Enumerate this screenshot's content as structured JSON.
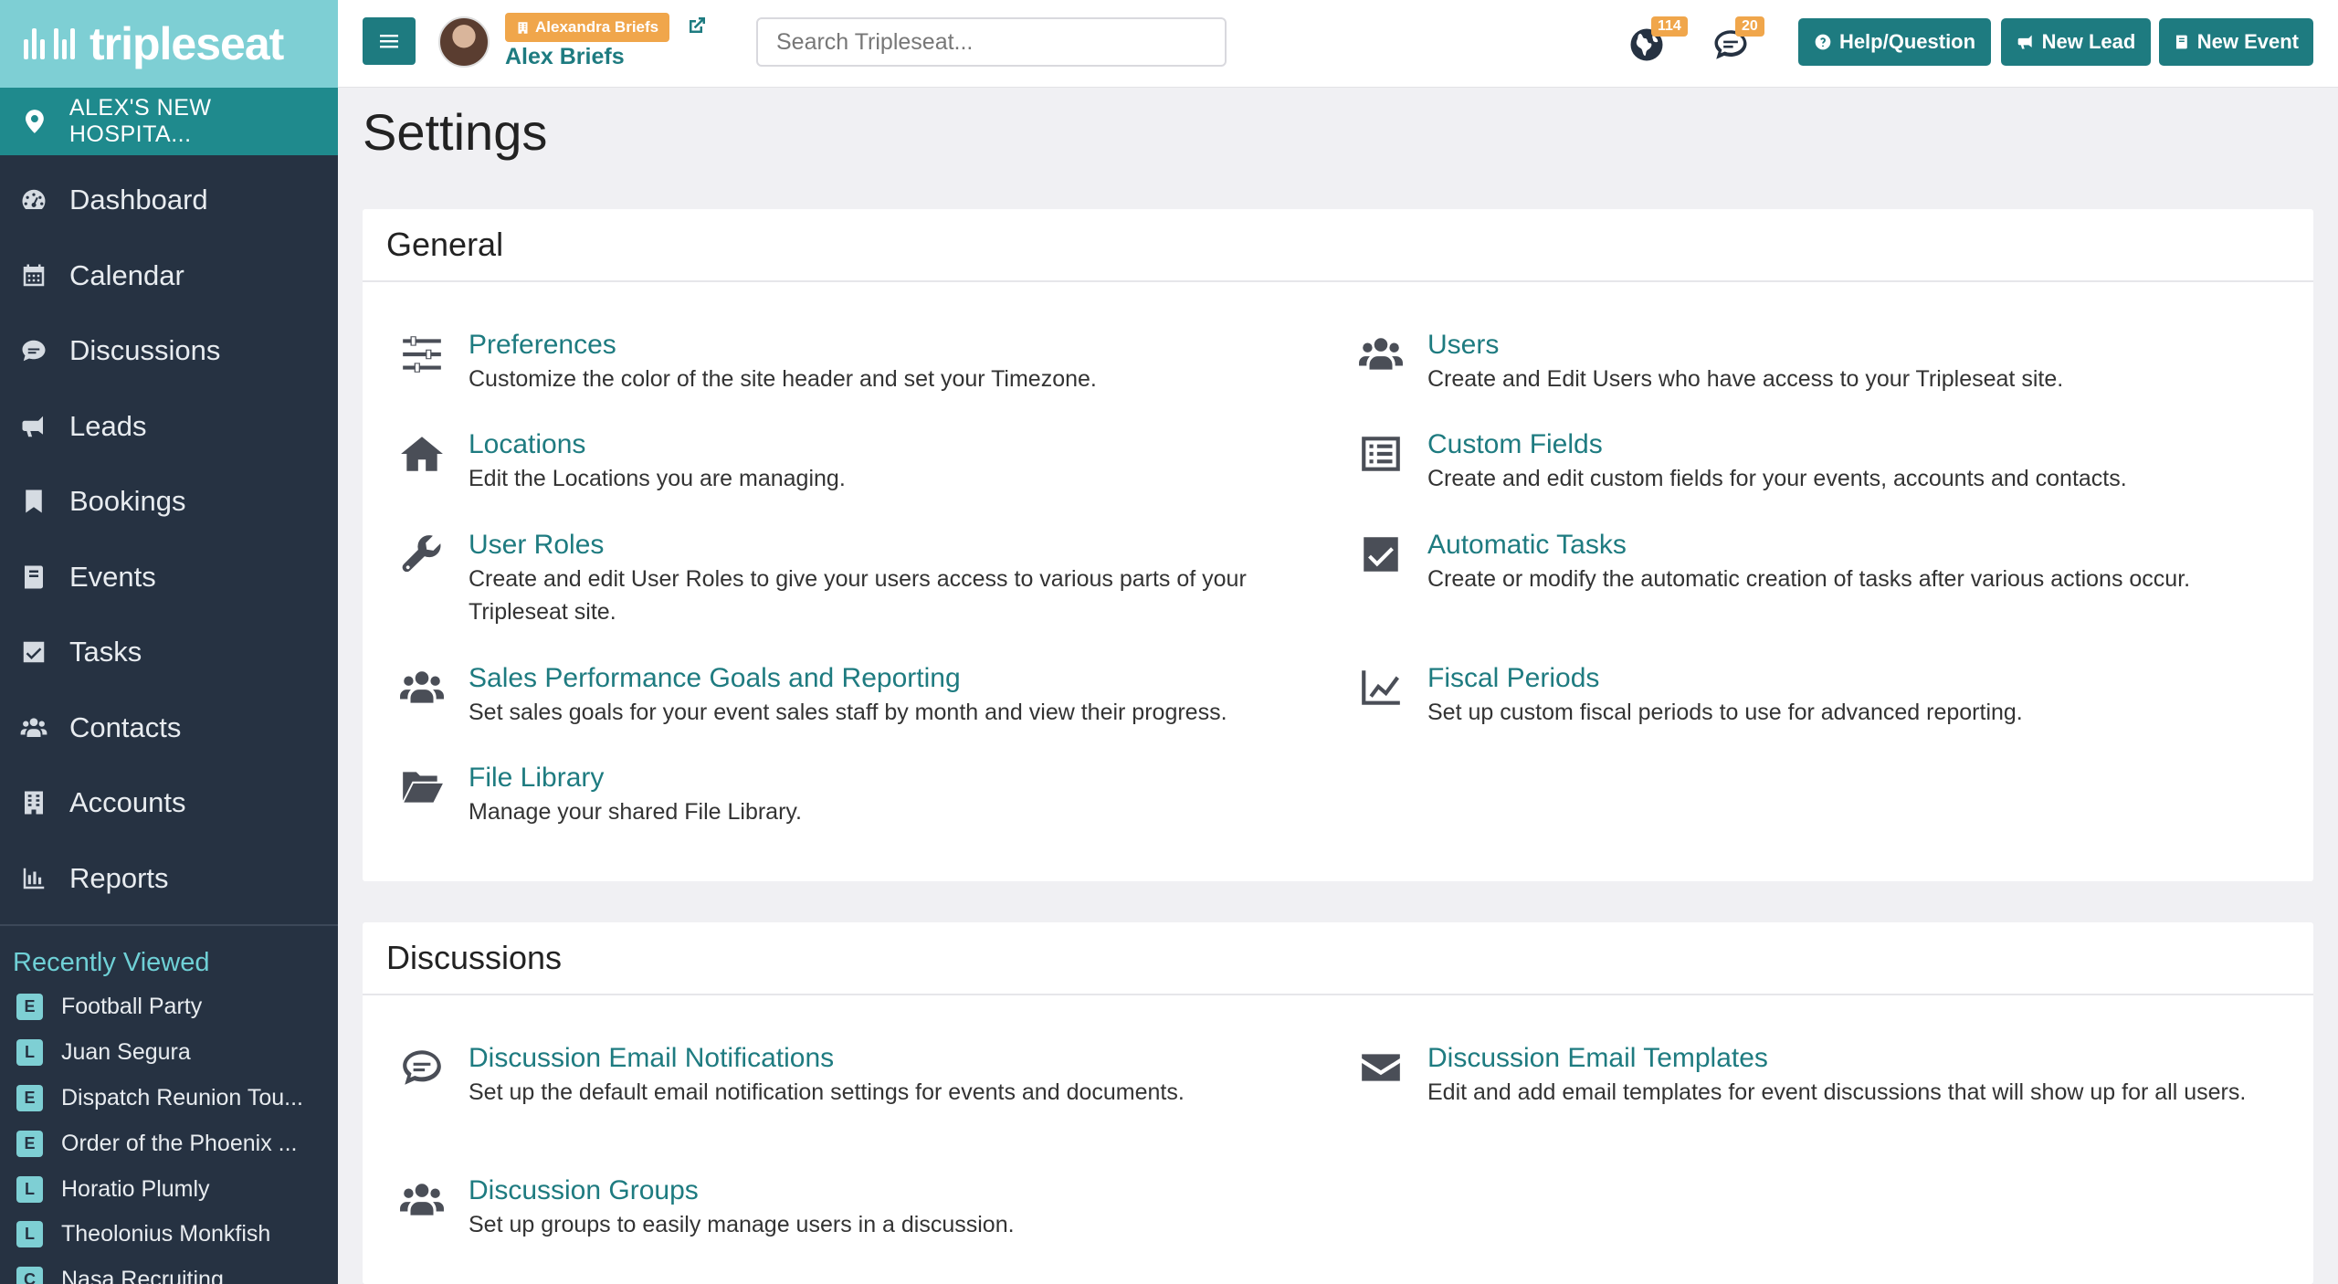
{
  "app": {
    "logo_text": "tripleseat"
  },
  "location": {
    "name": "ALEX'S NEW HOSPITA..."
  },
  "nav": [
    {
      "label": "Dashboard",
      "icon": "dashboard-icon"
    },
    {
      "label": "Calendar",
      "icon": "calendar-icon"
    },
    {
      "label": "Discussions",
      "icon": "chat-icon"
    },
    {
      "label": "Leads",
      "icon": "megaphone-icon"
    },
    {
      "label": "Bookings",
      "icon": "bookmark-icon"
    },
    {
      "label": "Events",
      "icon": "book-icon"
    },
    {
      "label": "Tasks",
      "icon": "checkbox-icon"
    },
    {
      "label": "Contacts",
      "icon": "users-icon"
    },
    {
      "label": "Accounts",
      "icon": "building-icon"
    },
    {
      "label": "Reports",
      "icon": "bar-chart-icon"
    }
  ],
  "recent": {
    "title": "Recently Viewed",
    "items": [
      {
        "badge": "E",
        "label": "Football Party"
      },
      {
        "badge": "L",
        "label": "Juan Segura"
      },
      {
        "badge": "E",
        "label": "Dispatch Reunion Tou..."
      },
      {
        "badge": "E",
        "label": "Order of the Phoenix ..."
      },
      {
        "badge": "L",
        "label": "Horatio Plumly"
      },
      {
        "badge": "L",
        "label": "Theolonius Monkfish"
      },
      {
        "badge": "C",
        "label": "Nasa Recruiting"
      }
    ]
  },
  "topbar": {
    "impersonating": "Alexandra Briefs",
    "user_name": "Alex Briefs",
    "search_placeholder": "Search Tripleseat...",
    "notifications_count": "114",
    "messages_count": "20",
    "help_label": "Help/Question",
    "new_lead_label": "New Lead",
    "new_event_label": "New Event"
  },
  "page": {
    "title": "Settings"
  },
  "sections": [
    {
      "title": "General",
      "items": [
        {
          "title": "Preferences",
          "desc": "Customize the color of the site header and set your Timezone.",
          "icon": "sliders-icon"
        },
        {
          "title": "Users",
          "desc": "Create and Edit Users who have access to your Tripleseat site.",
          "icon": "users-icon"
        },
        {
          "title": "Locations",
          "desc": "Edit the Locations you are managing.",
          "icon": "home-icon"
        },
        {
          "title": "Custom Fields",
          "desc": "Create and edit custom fields for your events, accounts and contacts.",
          "icon": "list-icon"
        },
        {
          "title": "User Roles",
          "desc": "Create and edit User Roles to give your users access to various parts of your Tripleseat site.",
          "icon": "wrench-icon"
        },
        {
          "title": "Automatic Tasks",
          "desc": "Create or modify the automatic creation of tasks after various actions occur.",
          "icon": "checkbox-icon"
        },
        {
          "title": "Sales Performance Goals and Reporting",
          "desc": "Set sales goals for your event sales staff by month and view their progress.",
          "icon": "users-icon"
        },
        {
          "title": "Fiscal Periods",
          "desc": "Set up custom fiscal periods to use for advanced reporting.",
          "icon": "line-chart-icon"
        },
        {
          "title": "File Library",
          "desc": "Manage your shared File Library.",
          "icon": "folder-open-icon"
        }
      ]
    },
    {
      "title": "Discussions",
      "items": [
        {
          "title": "Discussion Email Notifications",
          "desc": "Set up the default email notification settings for events and documents.",
          "icon": "chat-bubble-icon"
        },
        {
          "title": "Discussion Email Templates",
          "desc": "Edit and add email templates for event discussions that will show up for all users.",
          "icon": "envelope-icon"
        },
        {
          "title": "Discussion Groups",
          "desc": "Set up groups to easily manage users in a discussion.",
          "icon": "users-icon"
        }
      ]
    }
  ]
}
